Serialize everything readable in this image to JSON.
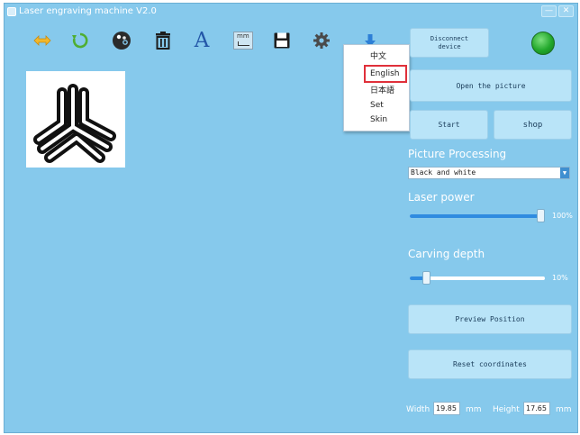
{
  "window": {
    "title": "Laser engraving machine V2.0",
    "minimize_glyph": "—",
    "close_glyph": "✕"
  },
  "toolbar": {
    "items": [
      {
        "icon": "swap-arrows-icon"
      },
      {
        "icon": "rotate-icon"
      },
      {
        "icon": "palette-icon"
      },
      {
        "icon": "trash-icon"
      },
      {
        "icon": "text-icon",
        "glyph": "A"
      },
      {
        "icon": "mm-ruler-icon",
        "glyph": "mm"
      },
      {
        "icon": "save-icon"
      },
      {
        "icon": "gear-icon"
      },
      {
        "icon": "download-arrow-icon"
      }
    ]
  },
  "language_menu": {
    "items": [
      "中文",
      "English",
      "日本語",
      "Set",
      "Skin"
    ],
    "highlighted": "English"
  },
  "device": {
    "disconnect_label": "Disconnect\ndevice",
    "status_color": "#22a82c"
  },
  "actions": {
    "open_picture": "Open the picture",
    "start": "Start",
    "shop": "shop",
    "preview_position": "Preview Position",
    "reset_coordinates": "Reset coordinates"
  },
  "picture_processing": {
    "label": "Picture Processing",
    "selected_mode": "Black and white"
  },
  "laser_power": {
    "label": "Laser power",
    "value_text": "100%",
    "value": 1.0
  },
  "carving_depth": {
    "label": "Carving depth",
    "value_text": "10%",
    "value": 0.1
  },
  "dimensions": {
    "width_label": "Width",
    "width_value": "19.85",
    "width_unit": "mm",
    "height_label": "Height",
    "height_value": "17.65",
    "height_unit": "mm"
  },
  "colors": {
    "background": "#86c9ec",
    "button": "#b9e4f8",
    "slider_fill": "#2f8be0",
    "highlight": "#e0303a"
  }
}
